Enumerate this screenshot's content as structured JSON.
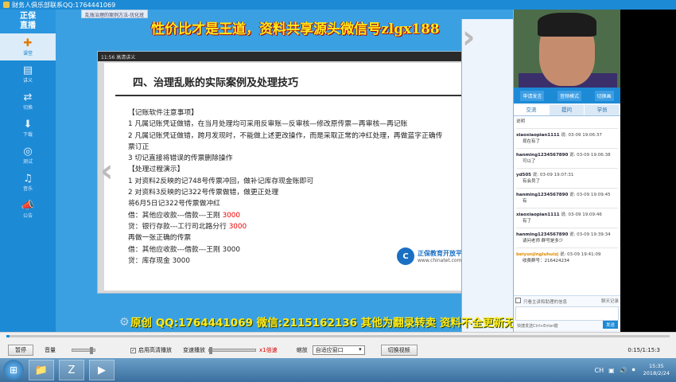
{
  "window": {
    "title": "财务人俱乐部联系QQ:1764441069"
  },
  "nav": {
    "logo_line1": "正保",
    "logo_line2": "直播",
    "items": [
      {
        "label": "课堂",
        "icon": "✚"
      },
      {
        "label": "讲义",
        "icon": "▤"
      },
      {
        "label": "切换",
        "icon": "⇄"
      },
      {
        "label": "下载",
        "icon": "⬇"
      },
      {
        "label": "测试",
        "icon": "◎"
      },
      {
        "label": "音乐",
        "icon": "♫"
      },
      {
        "label": "公告",
        "icon": "📣"
      }
    ]
  },
  "main": {
    "top_banner": "性价比才是王道，资料共享源头微信号zlgx188",
    "sub_tab": "乱账治理的案例方法-优化班",
    "player_header": "11:56 高清讲义",
    "slide": {
      "title": "四、治理乱账的实际案例及处理技巧",
      "lines": [
        {
          "text": "【记账软件注意事项】",
          "red_part": ""
        },
        {
          "text": "1 凡属记账凭证做错，在当月处理均可采用反审账—反审核—修改原传票—再审核—再记账",
          "red_part": ""
        },
        {
          "text": "2 凡属记账凭证做错，跨月发现时，不能做上述更改操作，而是采取正常的冲红处理，再做蓝字正确传",
          "red_part": ""
        },
        {
          "text": "票订正",
          "red_part": ""
        },
        {
          "text": "3 切记直接将错误的传票删除操作",
          "red_part": ""
        },
        {
          "text": "【处理过程演示】",
          "red_part": ""
        },
        {
          "text": "1 对资料2反映的记748号传票冲回，做补记库存现金账即可",
          "red_part": ""
        },
        {
          "text": "2 对资料3反映的记322号传票做错，做更正处理",
          "red_part": ""
        },
        {
          "text": "将6月5日记322号传票做冲红",
          "red_part": ""
        },
        {
          "text": "借：其他应收款---借款---王刚  ",
          "red_part": "3000"
        },
        {
          "text": " 贷：银行存款---工行司北路分行  ",
          "red_part": "3000"
        },
        {
          "text": "再做一张正确的传票",
          "red_part": ""
        },
        {
          "text": "借：其他应收款---借款---王刚      3000",
          "red_part": ""
        },
        {
          "text": "贷：库存现金            3000",
          "red_part": ""
        }
      ],
      "logo_text": "正保教育开放平台",
      "logo_url": "www.chinatet.com"
    },
    "bottom_banner": "原创 QQ:1764441069 微信:2115162136  其他为翻录转卖 资料不全更新无保障"
  },
  "right_panel": {
    "cam_buttons": [
      "申请发言",
      "音频模式",
      "切换画"
    ],
    "tabs": [
      "交流",
      "提问",
      "学员"
    ],
    "chat_header": "说明",
    "messages": [
      {
        "user": "xiaoxiaopian1111",
        "time": "03-09 19:06:37",
        "text": "现在有了",
        "orange": false
      },
      {
        "user": "hanming1234567890",
        "time": "03-09 19:06:38",
        "text": "可以了",
        "orange": false
      },
      {
        "user": "yd505",
        "time": "03-09 19:07:31",
        "text": "有会员了",
        "orange": false
      },
      {
        "user": "hanming1234567890",
        "time": "03-09 19:09:45",
        "text": "有",
        "orange": false
      },
      {
        "user": "xiaoxiaopian1111",
        "time": "03-09 19:09:46",
        "text": "有了",
        "orange": false
      },
      {
        "user": "hanming1234567890",
        "time": "03-09 19:39:34",
        "text": "请问老师  群号是多少",
        "orange": false
      },
      {
        "user": "beiyunjingluhuizj",
        "time": "03-09 19:41:09",
        "text": "收费群号：216424234",
        "orange": true
      }
    ],
    "input_left": "只看主讲和助理的信息",
    "input_right": "聊天记录",
    "input_hint": "快捷发送Ctrl+Enter键",
    "send_label": "发送"
  },
  "controls": {
    "pause_label": "暂停",
    "volume_label": "音量",
    "hd_label": "启用高清播放",
    "speed_label": "变速播放",
    "speed_value": "x1倍速",
    "zoom_label": "缩放",
    "zoom_value": "自适应窗口",
    "switch_label": "切换视频",
    "timecode": "0:15/1:15:3",
    "progress_fraction": 0.005
  },
  "taskbar": {
    "lang": "CH",
    "time": "15:35",
    "date": "2018/2/24"
  }
}
